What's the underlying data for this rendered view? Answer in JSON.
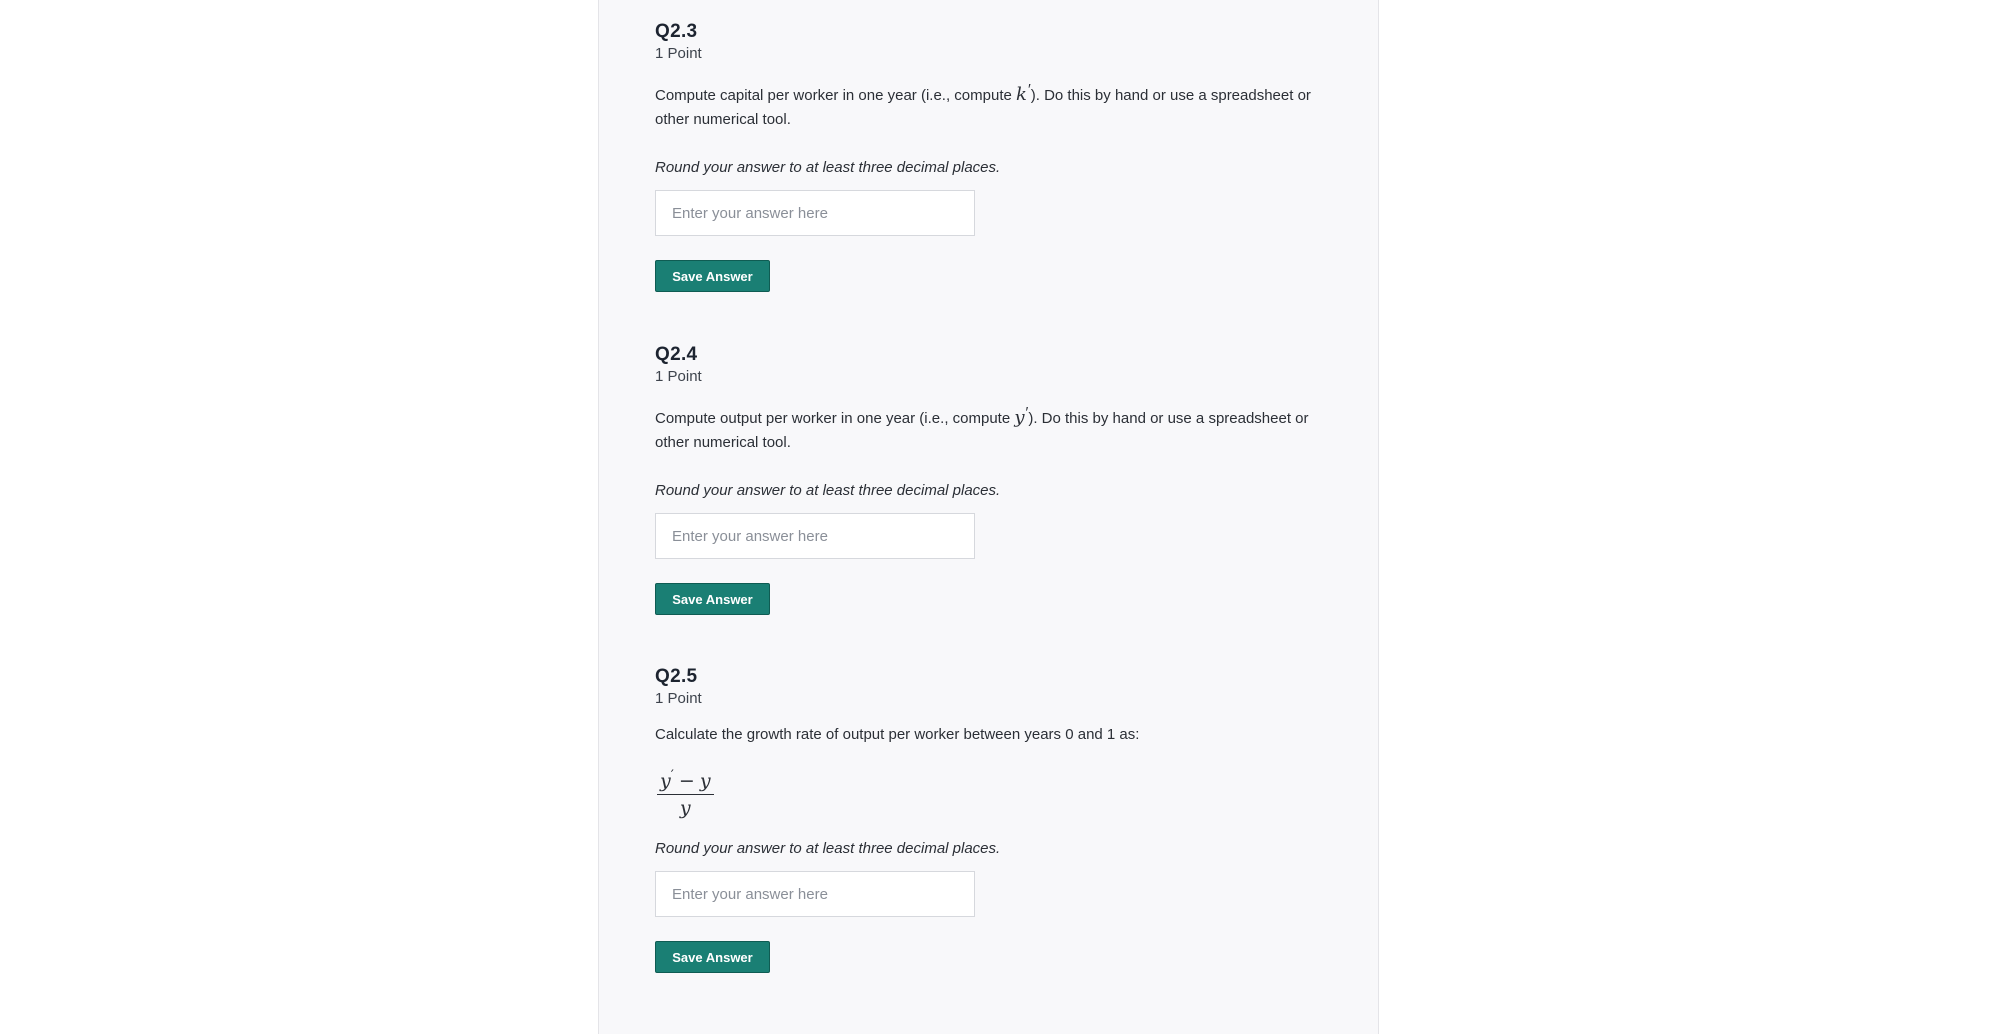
{
  "questions": [
    {
      "title": "Q2.3",
      "points": "1 Point",
      "text_before": "Compute capital per worker in one year (i.e., compute ",
      "math_var": "k",
      "math_prime": "′",
      "text_after": "). Do this by hand or use a spreadsheet or other numerical tool.",
      "round_note": "Round your answer to at least three decimal places.",
      "input_placeholder": "Enter your answer here",
      "input_value": "",
      "save_label": "Save Answer"
    },
    {
      "title": "Q2.4",
      "points": "1 Point",
      "text_before": "Compute output per worker in one year (i.e., compute ",
      "math_var": "y",
      "math_prime": "′",
      "text_after": "). Do this by hand or use a spreadsheet or other numerical tool.",
      "round_note": "Round your answer to at least three decimal places.",
      "input_placeholder": "Enter your answer here",
      "input_value": "",
      "save_label": "Save Answer"
    },
    {
      "title": "Q2.5",
      "points": "1 Point",
      "text": "Calculate the growth rate of output per worker between years 0 and 1 as:",
      "formula": {
        "num_var1": "y",
        "num_prime": "′",
        "num_minus": "−",
        "num_var2": "y",
        "den_var": "y"
      },
      "round_note": "Round your answer to at least three decimal places.",
      "input_placeholder": "Enter your answer here",
      "input_value": "",
      "save_label": "Save Answer"
    }
  ]
}
